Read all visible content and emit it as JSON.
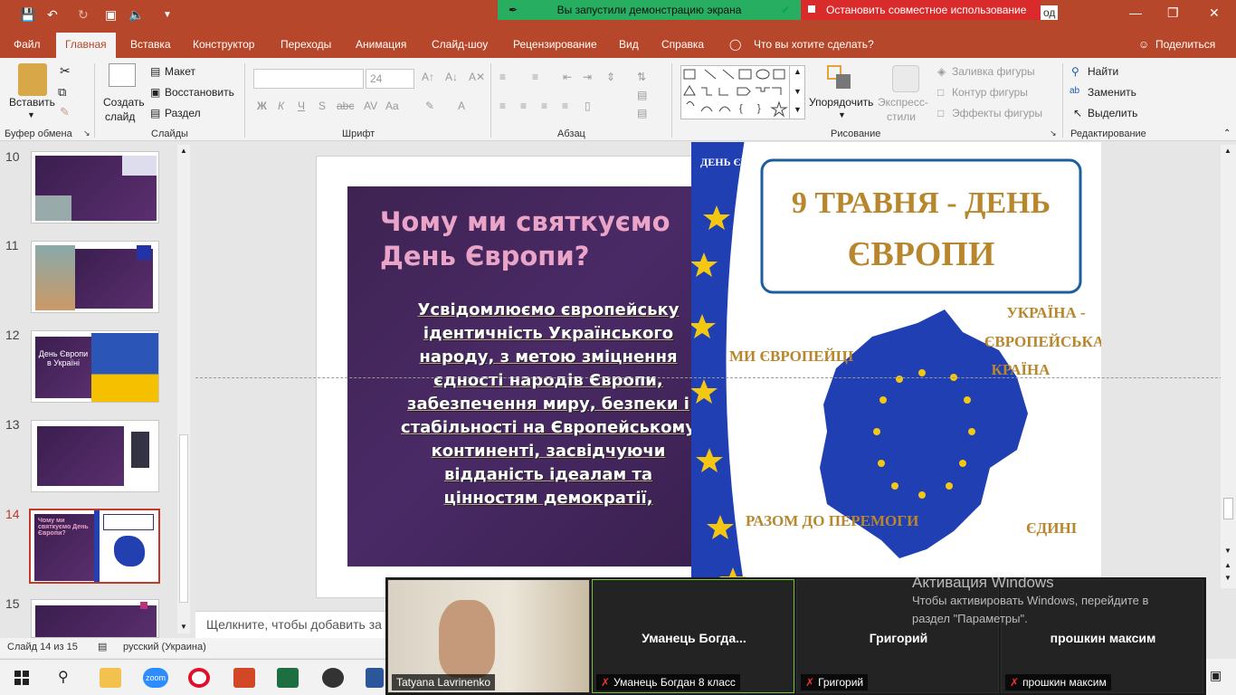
{
  "titlebar": {
    "share_status": "Вы запустили демонстрацию экрана",
    "stop_share": "Остановить совместное использование",
    "partial_right": "од"
  },
  "tabs": [
    "Файл",
    "Главная",
    "Вставка",
    "Конструктор",
    "Переходы",
    "Анимация",
    "Слайд-шоу",
    "Рецензирование",
    "Вид",
    "Справка"
  ],
  "tell_me": "Что вы хотите сделать?",
  "share": "Поделиться",
  "ribbon": {
    "paste": "Вставить",
    "clipboard_group": "Буфер обмена",
    "create_slide_1": "Создать",
    "create_slide_2": "слайд",
    "layout": "Макет",
    "reset": "Восстановить",
    "section": "Раздел",
    "slides_group": "Слайды",
    "font_size": "24",
    "font_group": "Шрифт",
    "paragraph_group": "Абзац",
    "arrange_1": "Упорядочить",
    "quick_styles_1": "Экспресс-",
    "quick_styles_2": "стили",
    "shape_fill": "Заливка фигуры",
    "shape_outline": "Контур фигуры",
    "shape_effects": "Эффекты фигуры",
    "drawing_group": "Рисование",
    "find": "Найти",
    "replace": "Заменить",
    "select": "Выделить",
    "editing_group": "Редактирование"
  },
  "thumbnails": [
    {
      "num": "10"
    },
    {
      "num": "11"
    },
    {
      "num": "12",
      "text": "День Європи в Україні"
    },
    {
      "num": "13"
    },
    {
      "num": "14",
      "text": "Чому ми святкуємо День Європи?"
    },
    {
      "num": "15"
    }
  ],
  "slide": {
    "title": "Чому ми святкуємо День Європи?",
    "body": "Усвідомлюємо європейську ідентичність Українського народу, з метою зміцнення єдності народів Європи, забезпечення миру, безпеки і стабільності на Європейському континенті, засвідчуючи відданість ідеалам та цінностям демократії,",
    "img_corner": "ДЕНЬ ЄВРОПИ",
    "img_header_1": "9 ТРАВНЯ  - ДЕНЬ",
    "img_header_2": "ЄВРОПИ",
    "img_left": "МИ ЄВРОПЕЙЦІ",
    "img_right_1": "УКРАЇНА -",
    "img_right_2": "ЄВРОПЕЙСЬКА",
    "img_right_3": "КРАЇНА",
    "img_bottom_left": "РАЗОМ ДО ПЕРЕМОГИ",
    "img_bottom_right": "ЄДИНІ"
  },
  "notes_placeholder": "Щелкните, чтобы добавить за",
  "status": {
    "slide_count": "Слайд 14 из 15",
    "language": "русский (Украина)"
  },
  "activation": {
    "title": "Активация Windows",
    "line1": "Чтобы активировать Windows, перейдите в",
    "line2": "раздел \"Параметры\"."
  },
  "zoom": {
    "tiles": [
      {
        "label": "Tatyana Lavrinenko",
        "name": ""
      },
      {
        "label": "Уманець Богдан 8 класс",
        "name": "Уманець  Богда..."
      },
      {
        "label": "Григорий",
        "name": "Григорий"
      },
      {
        "label": "прошкин максим",
        "name": "прошкин максим"
      }
    ]
  },
  "colors": {
    "accent": "#b7472a",
    "slide_dark": "#4a2a66",
    "title_pink": "#e9a4c7",
    "eu_blue": "#1f3fb3",
    "gold": "#f3c712"
  },
  "taskbar": {
    "zoom": "zoom"
  }
}
